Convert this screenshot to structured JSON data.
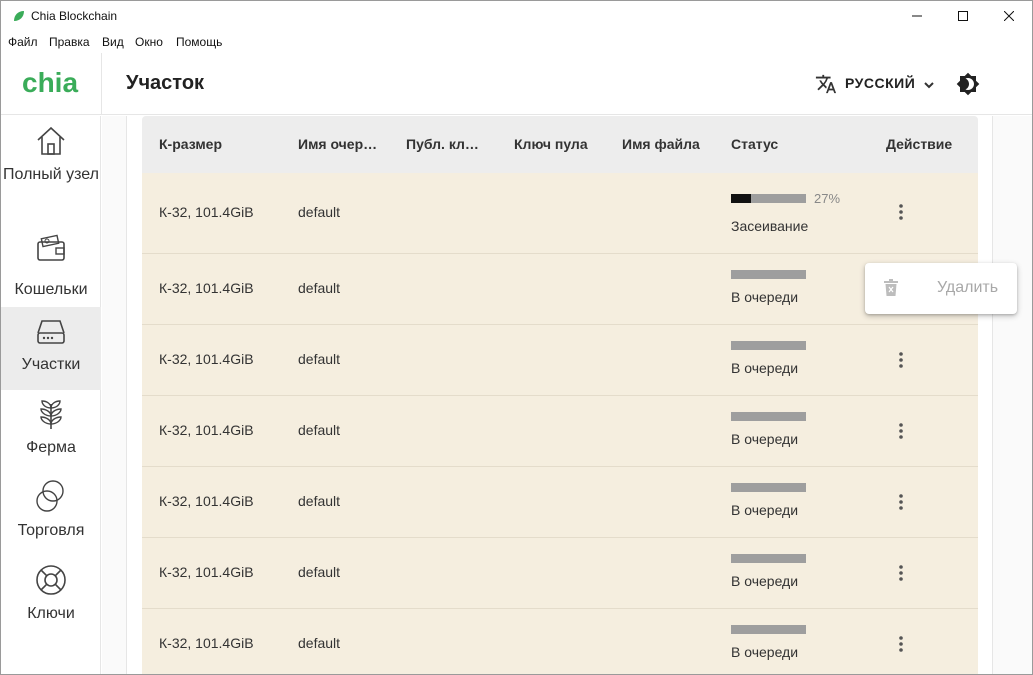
{
  "window": {
    "title": "Chia Blockchain",
    "menu": [
      "Файл",
      "Правка",
      "Вид",
      "Окно",
      "Помощь"
    ]
  },
  "header": {
    "logo_text": "chia",
    "page_title": "Участок",
    "language": "РУССКИЙ",
    "icons": [
      "translate-icon",
      "chevron-down-icon",
      "brightness-icon"
    ]
  },
  "sidebar": {
    "items": [
      {
        "label": "Полный узел",
        "icon": "home-icon",
        "active": false
      },
      {
        "label": "Кошельки",
        "icon": "wallet-icon",
        "active": false
      },
      {
        "label": "Участки",
        "icon": "hdd-icon",
        "active": true
      },
      {
        "label": "Ферма",
        "icon": "plant-icon",
        "active": false
      },
      {
        "label": "Торговля",
        "icon": "trade-icon",
        "active": false
      },
      {
        "label": "Ключи",
        "icon": "lifebuoy-icon",
        "active": false
      }
    ]
  },
  "table": {
    "headers": [
      "К-размер",
      "Имя очер…",
      "Публ. кл…",
      "Ключ пула",
      "Имя файла",
      "Статус",
      "Действие"
    ],
    "rows": [
      {
        "ksize": "К-32, 101.4GiB",
        "queue": "default",
        "progress": 0.27,
        "progress_label": "27%",
        "status": "Засеивание"
      },
      {
        "ksize": "К-32, 101.4GiB",
        "queue": "default",
        "progress": 0,
        "progress_label": "",
        "status": "В очереди"
      },
      {
        "ksize": "К-32, 101.4GiB",
        "queue": "default",
        "progress": 0,
        "progress_label": "",
        "status": "В очереди"
      },
      {
        "ksize": "К-32, 101.4GiB",
        "queue": "default",
        "progress": 0,
        "progress_label": "",
        "status": "В очереди"
      },
      {
        "ksize": "К-32, 101.4GiB",
        "queue": "default",
        "progress": 0,
        "progress_label": "",
        "status": "В очереди"
      },
      {
        "ksize": "К-32, 101.4GiB",
        "queue": "default",
        "progress": 0,
        "progress_label": "",
        "status": "В очереди"
      },
      {
        "ksize": "К-32, 101.4GiB",
        "queue": "default",
        "progress": 0,
        "progress_label": "",
        "status": "В очереди"
      }
    ]
  },
  "popup_menu": {
    "delete_label": "Удалить",
    "icon": "trash-icon"
  },
  "colors": {
    "brand_green": "#3aac59",
    "row_background": "#f5eedf",
    "header_background": "#ededed"
  }
}
